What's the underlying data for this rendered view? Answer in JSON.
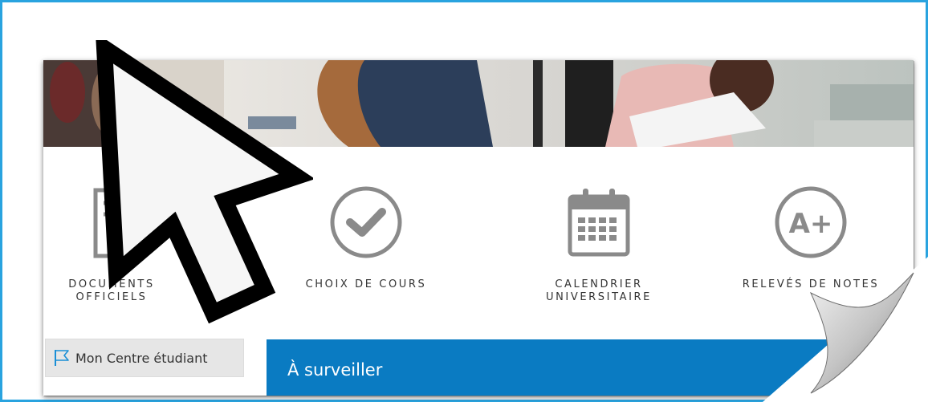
{
  "tiles": [
    {
      "label": "DOCUMENTS\nOFFICIELS",
      "icon": "certificate-icon"
    },
    {
      "label": "CHOIX DE COURS",
      "icon": "checkmark-circle-icon"
    },
    {
      "label": "CALENDRIER\nUNIVERSITAIRE",
      "icon": "calendar-icon"
    },
    {
      "label": "RELEVÉS DE NOTES",
      "icon": "grade-a-plus-icon"
    }
  ],
  "grade_icon_text": "A+",
  "student_center": {
    "label": "Mon Centre étudiant",
    "icon": "flag-icon"
  },
  "watch": {
    "title": "À surveiller"
  },
  "colors": {
    "accent": "#0a7bc2",
    "frame": "#29a3df",
    "icon_gray": "#8a8a8a"
  }
}
